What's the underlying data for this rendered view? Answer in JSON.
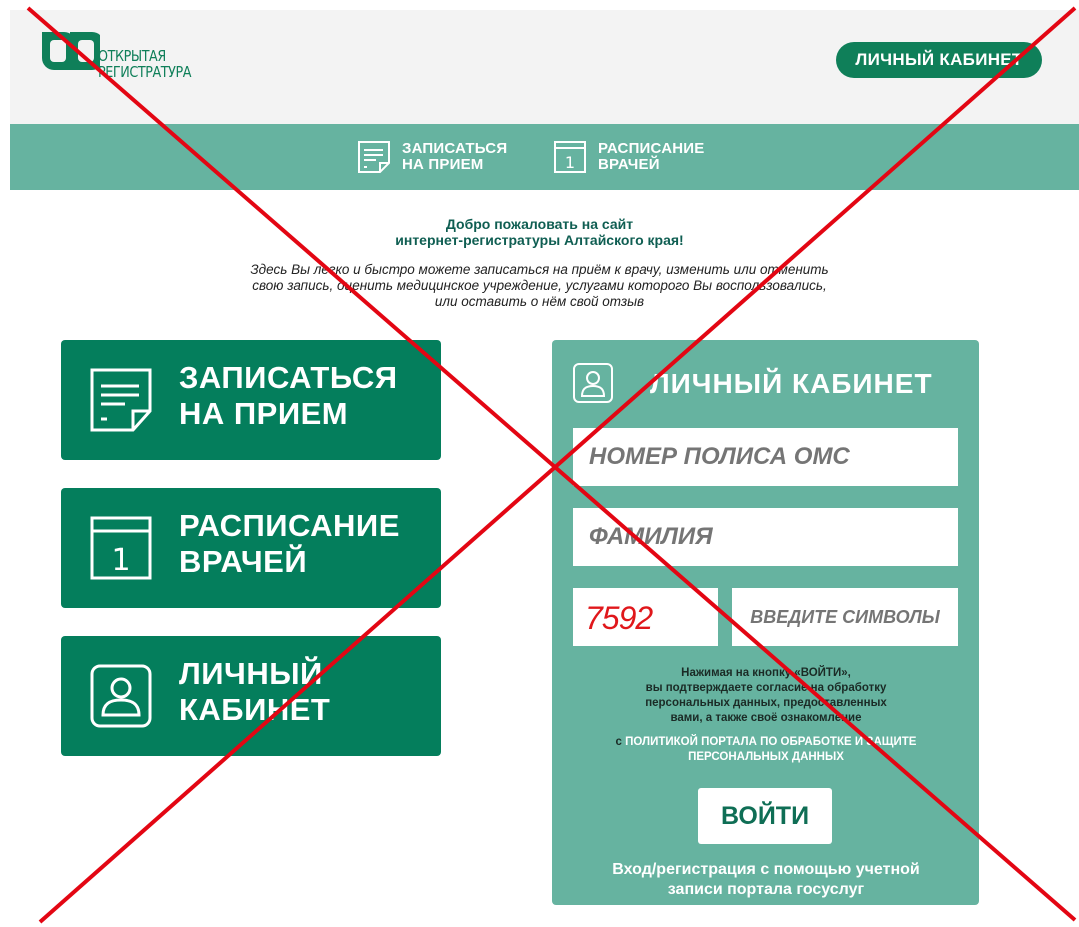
{
  "header": {
    "logo_text_line1": "ОТКРЫТАЯ",
    "logo_text_line2": "РЕГИСТРАТУРА",
    "account_button": "ЛИЧНЫЙ КАБИНЕТ"
  },
  "nav": {
    "items": [
      {
        "label": "ЗАПИСАТЬСЯ\nНА ПРИЕМ",
        "icon": "appointment-note-icon"
      },
      {
        "label": "РАСПИСАНИЕ\nВРАЧЕЙ",
        "icon": "calendar-icon"
      }
    ]
  },
  "welcome": {
    "title": "Добро пожаловать на сайт\nинтернет-регистратуры Алтайского края!",
    "text": "Здесь Вы легко и быстро можете записаться на приём к врачу, изменить или отменить\nсвою запись, оценить медицинское учреждение, услугами которого Вы воспользовались,\nили оставить о нём свой отзыв"
  },
  "big_buttons": [
    {
      "label": "ЗАПИСАТЬСЯ\nНА ПРИЕМ",
      "icon": "appointment-note-icon"
    },
    {
      "label": "РАСПИСАНИЕ\nВРАЧЕЙ",
      "icon": "calendar-icon"
    },
    {
      "label": "ЛИЧНЫЙ\nКАБИНЕТ",
      "icon": "user-icon"
    }
  ],
  "login": {
    "title": "ЛИЧНЫЙ КАБИНЕТ",
    "icon": "user-icon",
    "oms_placeholder": "НОМЕР ПОЛИСА ОМС",
    "surname_placeholder": "ФАМИЛИЯ",
    "captcha_value": "7592",
    "captcha_placeholder": "ВВЕДИТЕ СИМВОЛЫ",
    "consent_text": "Нажимая на кнопку «ВОЙТИ»,\nвы подтверждаете согласие на обработку\nперсональных данных, предоставленных\nвами, а также своё ознакомление",
    "consent_prefix": "с ",
    "policy_link": "ПОЛИТИКОЙ ПОРТАЛА ПО ОБРАБОТКЕ И ЗАЩИТЕ\nПЕРСОНАЛЬНЫХ ДАННЫХ",
    "submit_label": "ВОЙТИ",
    "gosuslugi_link": "Вход/регистрация с помощью учетной\nзаписи портала госуслуг"
  },
  "colors": {
    "brand_green": "#047e5c",
    "light_green": "#66b3a0",
    "captcha_red": "#e0171b",
    "cross_red": "#e30613"
  }
}
